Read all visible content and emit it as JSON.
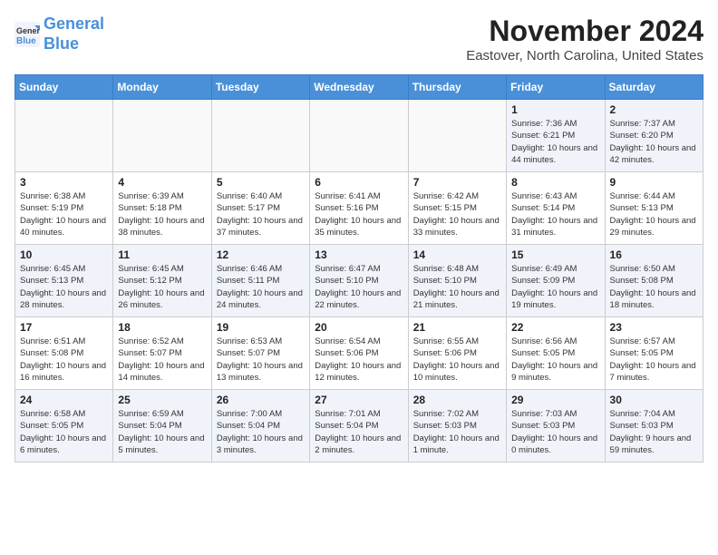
{
  "header": {
    "logo_line1": "General",
    "logo_line2": "Blue",
    "month": "November 2024",
    "location": "Eastover, North Carolina, United States"
  },
  "weekdays": [
    "Sunday",
    "Monday",
    "Tuesday",
    "Wednesday",
    "Thursday",
    "Friday",
    "Saturday"
  ],
  "weeks": [
    [
      {
        "day": "",
        "info": ""
      },
      {
        "day": "",
        "info": ""
      },
      {
        "day": "",
        "info": ""
      },
      {
        "day": "",
        "info": ""
      },
      {
        "day": "",
        "info": ""
      },
      {
        "day": "1",
        "info": "Sunrise: 7:36 AM\nSunset: 6:21 PM\nDaylight: 10 hours and 44 minutes."
      },
      {
        "day": "2",
        "info": "Sunrise: 7:37 AM\nSunset: 6:20 PM\nDaylight: 10 hours and 42 minutes."
      }
    ],
    [
      {
        "day": "3",
        "info": "Sunrise: 6:38 AM\nSunset: 5:19 PM\nDaylight: 10 hours and 40 minutes."
      },
      {
        "day": "4",
        "info": "Sunrise: 6:39 AM\nSunset: 5:18 PM\nDaylight: 10 hours and 38 minutes."
      },
      {
        "day": "5",
        "info": "Sunrise: 6:40 AM\nSunset: 5:17 PM\nDaylight: 10 hours and 37 minutes."
      },
      {
        "day": "6",
        "info": "Sunrise: 6:41 AM\nSunset: 5:16 PM\nDaylight: 10 hours and 35 minutes."
      },
      {
        "day": "7",
        "info": "Sunrise: 6:42 AM\nSunset: 5:15 PM\nDaylight: 10 hours and 33 minutes."
      },
      {
        "day": "8",
        "info": "Sunrise: 6:43 AM\nSunset: 5:14 PM\nDaylight: 10 hours and 31 minutes."
      },
      {
        "day": "9",
        "info": "Sunrise: 6:44 AM\nSunset: 5:13 PM\nDaylight: 10 hours and 29 minutes."
      }
    ],
    [
      {
        "day": "10",
        "info": "Sunrise: 6:45 AM\nSunset: 5:13 PM\nDaylight: 10 hours and 28 minutes."
      },
      {
        "day": "11",
        "info": "Sunrise: 6:45 AM\nSunset: 5:12 PM\nDaylight: 10 hours and 26 minutes."
      },
      {
        "day": "12",
        "info": "Sunrise: 6:46 AM\nSunset: 5:11 PM\nDaylight: 10 hours and 24 minutes."
      },
      {
        "day": "13",
        "info": "Sunrise: 6:47 AM\nSunset: 5:10 PM\nDaylight: 10 hours and 22 minutes."
      },
      {
        "day": "14",
        "info": "Sunrise: 6:48 AM\nSunset: 5:10 PM\nDaylight: 10 hours and 21 minutes."
      },
      {
        "day": "15",
        "info": "Sunrise: 6:49 AM\nSunset: 5:09 PM\nDaylight: 10 hours and 19 minutes."
      },
      {
        "day": "16",
        "info": "Sunrise: 6:50 AM\nSunset: 5:08 PM\nDaylight: 10 hours and 18 minutes."
      }
    ],
    [
      {
        "day": "17",
        "info": "Sunrise: 6:51 AM\nSunset: 5:08 PM\nDaylight: 10 hours and 16 minutes."
      },
      {
        "day": "18",
        "info": "Sunrise: 6:52 AM\nSunset: 5:07 PM\nDaylight: 10 hours and 14 minutes."
      },
      {
        "day": "19",
        "info": "Sunrise: 6:53 AM\nSunset: 5:07 PM\nDaylight: 10 hours and 13 minutes."
      },
      {
        "day": "20",
        "info": "Sunrise: 6:54 AM\nSunset: 5:06 PM\nDaylight: 10 hours and 12 minutes."
      },
      {
        "day": "21",
        "info": "Sunrise: 6:55 AM\nSunset: 5:06 PM\nDaylight: 10 hours and 10 minutes."
      },
      {
        "day": "22",
        "info": "Sunrise: 6:56 AM\nSunset: 5:05 PM\nDaylight: 10 hours and 9 minutes."
      },
      {
        "day": "23",
        "info": "Sunrise: 6:57 AM\nSunset: 5:05 PM\nDaylight: 10 hours and 7 minutes."
      }
    ],
    [
      {
        "day": "24",
        "info": "Sunrise: 6:58 AM\nSunset: 5:05 PM\nDaylight: 10 hours and 6 minutes."
      },
      {
        "day": "25",
        "info": "Sunrise: 6:59 AM\nSunset: 5:04 PM\nDaylight: 10 hours and 5 minutes."
      },
      {
        "day": "26",
        "info": "Sunrise: 7:00 AM\nSunset: 5:04 PM\nDaylight: 10 hours and 3 minutes."
      },
      {
        "day": "27",
        "info": "Sunrise: 7:01 AM\nSunset: 5:04 PM\nDaylight: 10 hours and 2 minutes."
      },
      {
        "day": "28",
        "info": "Sunrise: 7:02 AM\nSunset: 5:03 PM\nDaylight: 10 hours and 1 minute."
      },
      {
        "day": "29",
        "info": "Sunrise: 7:03 AM\nSunset: 5:03 PM\nDaylight: 10 hours and 0 minutes."
      },
      {
        "day": "30",
        "info": "Sunrise: 7:04 AM\nSunset: 5:03 PM\nDaylight: 9 hours and 59 minutes."
      }
    ]
  ]
}
